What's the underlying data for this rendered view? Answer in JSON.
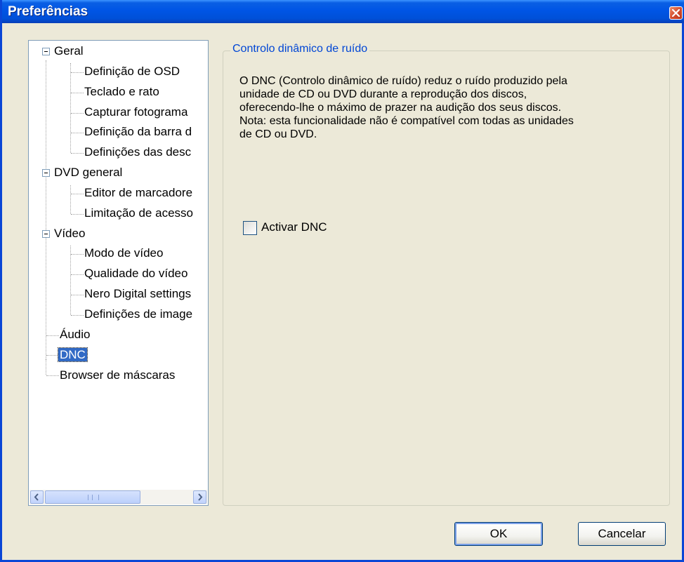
{
  "window": {
    "title": "Preferências",
    "close_glyph": "×"
  },
  "tree": {
    "items": [
      {
        "label": "Geral"
      },
      {
        "label": "Definição de OSD"
      },
      {
        "label": "Teclado e rato"
      },
      {
        "label": "Capturar fotograma"
      },
      {
        "label": "Definição da barra d"
      },
      {
        "label": "Definições das desc"
      },
      {
        "label": "DVD general"
      },
      {
        "label": "Editor de marcadore"
      },
      {
        "label": "Limitação de acesso"
      },
      {
        "label": "Vídeo"
      },
      {
        "label": "Modo de vídeo"
      },
      {
        "label": "Qualidade do vídeo"
      },
      {
        "label": "Nero Digital settings"
      },
      {
        "label": "Definições de image"
      },
      {
        "label": "Áudio"
      },
      {
        "label": "DNC"
      },
      {
        "label": "Browser de máscaras"
      }
    ],
    "selected": "DNC"
  },
  "panel": {
    "group_title": "Controlo dinâmico de ruído",
    "description_lines": [
      "O DNC (Controlo dinâmico de ruído) reduz o ruído produzido pela",
      "unidade de CD ou DVD durante a reprodução dos discos,",
      "oferecendo-lhe o máximo de prazer na audição dos seus discos.",
      "Nota: esta funcionalidade não é compatível com todas as unidades",
      "de CD ou DVD."
    ],
    "checkbox_label": "Activar DNC",
    "checkbox_checked": false
  },
  "buttons": {
    "ok": "OK",
    "cancel": "Cancelar"
  },
  "colors": {
    "titlebar": "#0055e5",
    "selection": "#316ac5",
    "group_title": "#0046d5"
  }
}
